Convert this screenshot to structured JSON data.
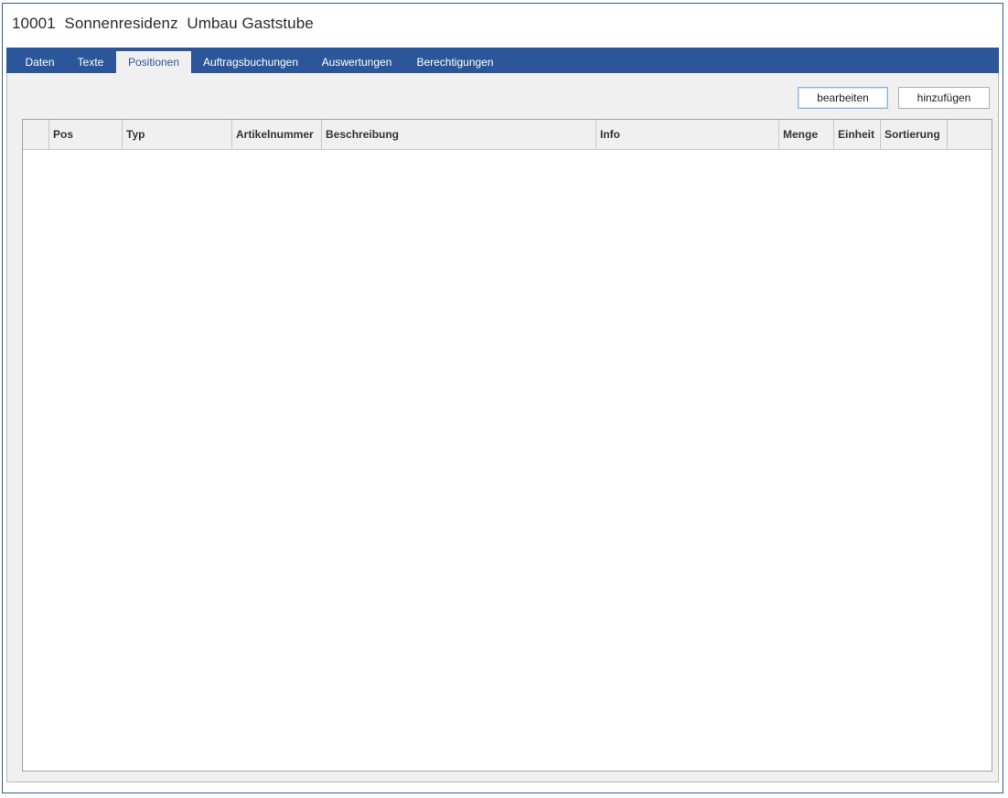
{
  "window": {
    "title": "10001  Sonnenresidenz  Umbau Gaststube"
  },
  "tabs": [
    {
      "label": "Daten",
      "active": false
    },
    {
      "label": "Texte",
      "active": false
    },
    {
      "label": "Positionen",
      "active": true
    },
    {
      "label": "Auftragsbuchungen",
      "active": false
    },
    {
      "label": "Auswertungen",
      "active": false
    },
    {
      "label": "Berechtigungen",
      "active": false
    }
  ],
  "toolbar": {
    "edit_label": "bearbeiten",
    "add_label": "hinzufügen"
  },
  "grid": {
    "columns": [
      {
        "label": ""
      },
      {
        "label": "Pos"
      },
      {
        "label": "Typ"
      },
      {
        "label": "Artikelnummer"
      },
      {
        "label": "Beschreibung"
      },
      {
        "label": "Info"
      },
      {
        "label": "Menge"
      },
      {
        "label": "Einheit"
      },
      {
        "label": "Sortierung"
      },
      {
        "label": ""
      }
    ],
    "rows": []
  },
  "colors": {
    "accent": "#2b579a",
    "panel": "#f0f0f0",
    "focus_border": "#7fb4e0"
  }
}
